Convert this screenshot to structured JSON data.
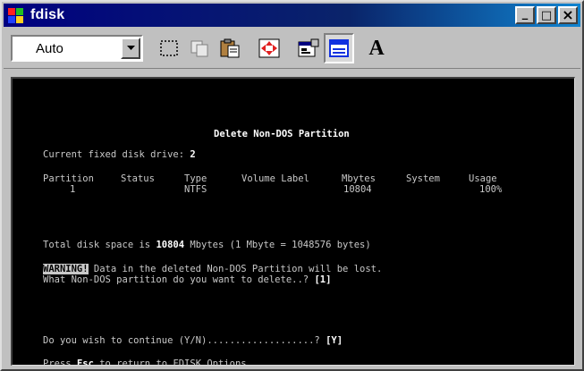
{
  "window": {
    "title": "fdisk",
    "minimize_glyph": "_",
    "maximize_glyph": "□",
    "close_glyph": "×",
    "titlebar_color": "#000080"
  },
  "toolbar": {
    "font_size_select": {
      "value": "Auto"
    },
    "tools": [
      "mark-icon",
      "copy-icon",
      "paste-icon",
      "fullscreen-icon",
      "properties-icon",
      "background-icon",
      "font-icon"
    ],
    "font_button_label": "A"
  },
  "console": {
    "heading": "Delete Non-DOS Partition",
    "current_drive": {
      "label": "Current fixed disk drive:",
      "value": "2"
    },
    "table_headers": [
      "Partition",
      "Status",
      "Type",
      "Volume Label",
      "Mbytes",
      "System",
      "Usage"
    ],
    "rows": [
      {
        "partition": "1",
        "status": "",
        "type": "NTFS",
        "volume_label": "",
        "mbytes": "10804",
        "system": "",
        "usage": "100%"
      }
    ],
    "total_space": {
      "prefix": "Total disk space is ",
      "value": "10804",
      "suffix": " Mbytes (1 Mbyte = 1048576 bytes)"
    },
    "warning_label": "WARNING!",
    "warning_text": " Data in the deleted Non-DOS Partition will be lost.",
    "question": "What Non-DOS partition do you want to delete..? ",
    "question_answer": "[1]",
    "continue_prompt": "Do you wish to continue (Y/N)...................? ",
    "continue_answer": "[Y]",
    "esc_prefix": "Press ",
    "esc_key": "Esc",
    "esc_suffix": " to return to FDISK Options"
  }
}
